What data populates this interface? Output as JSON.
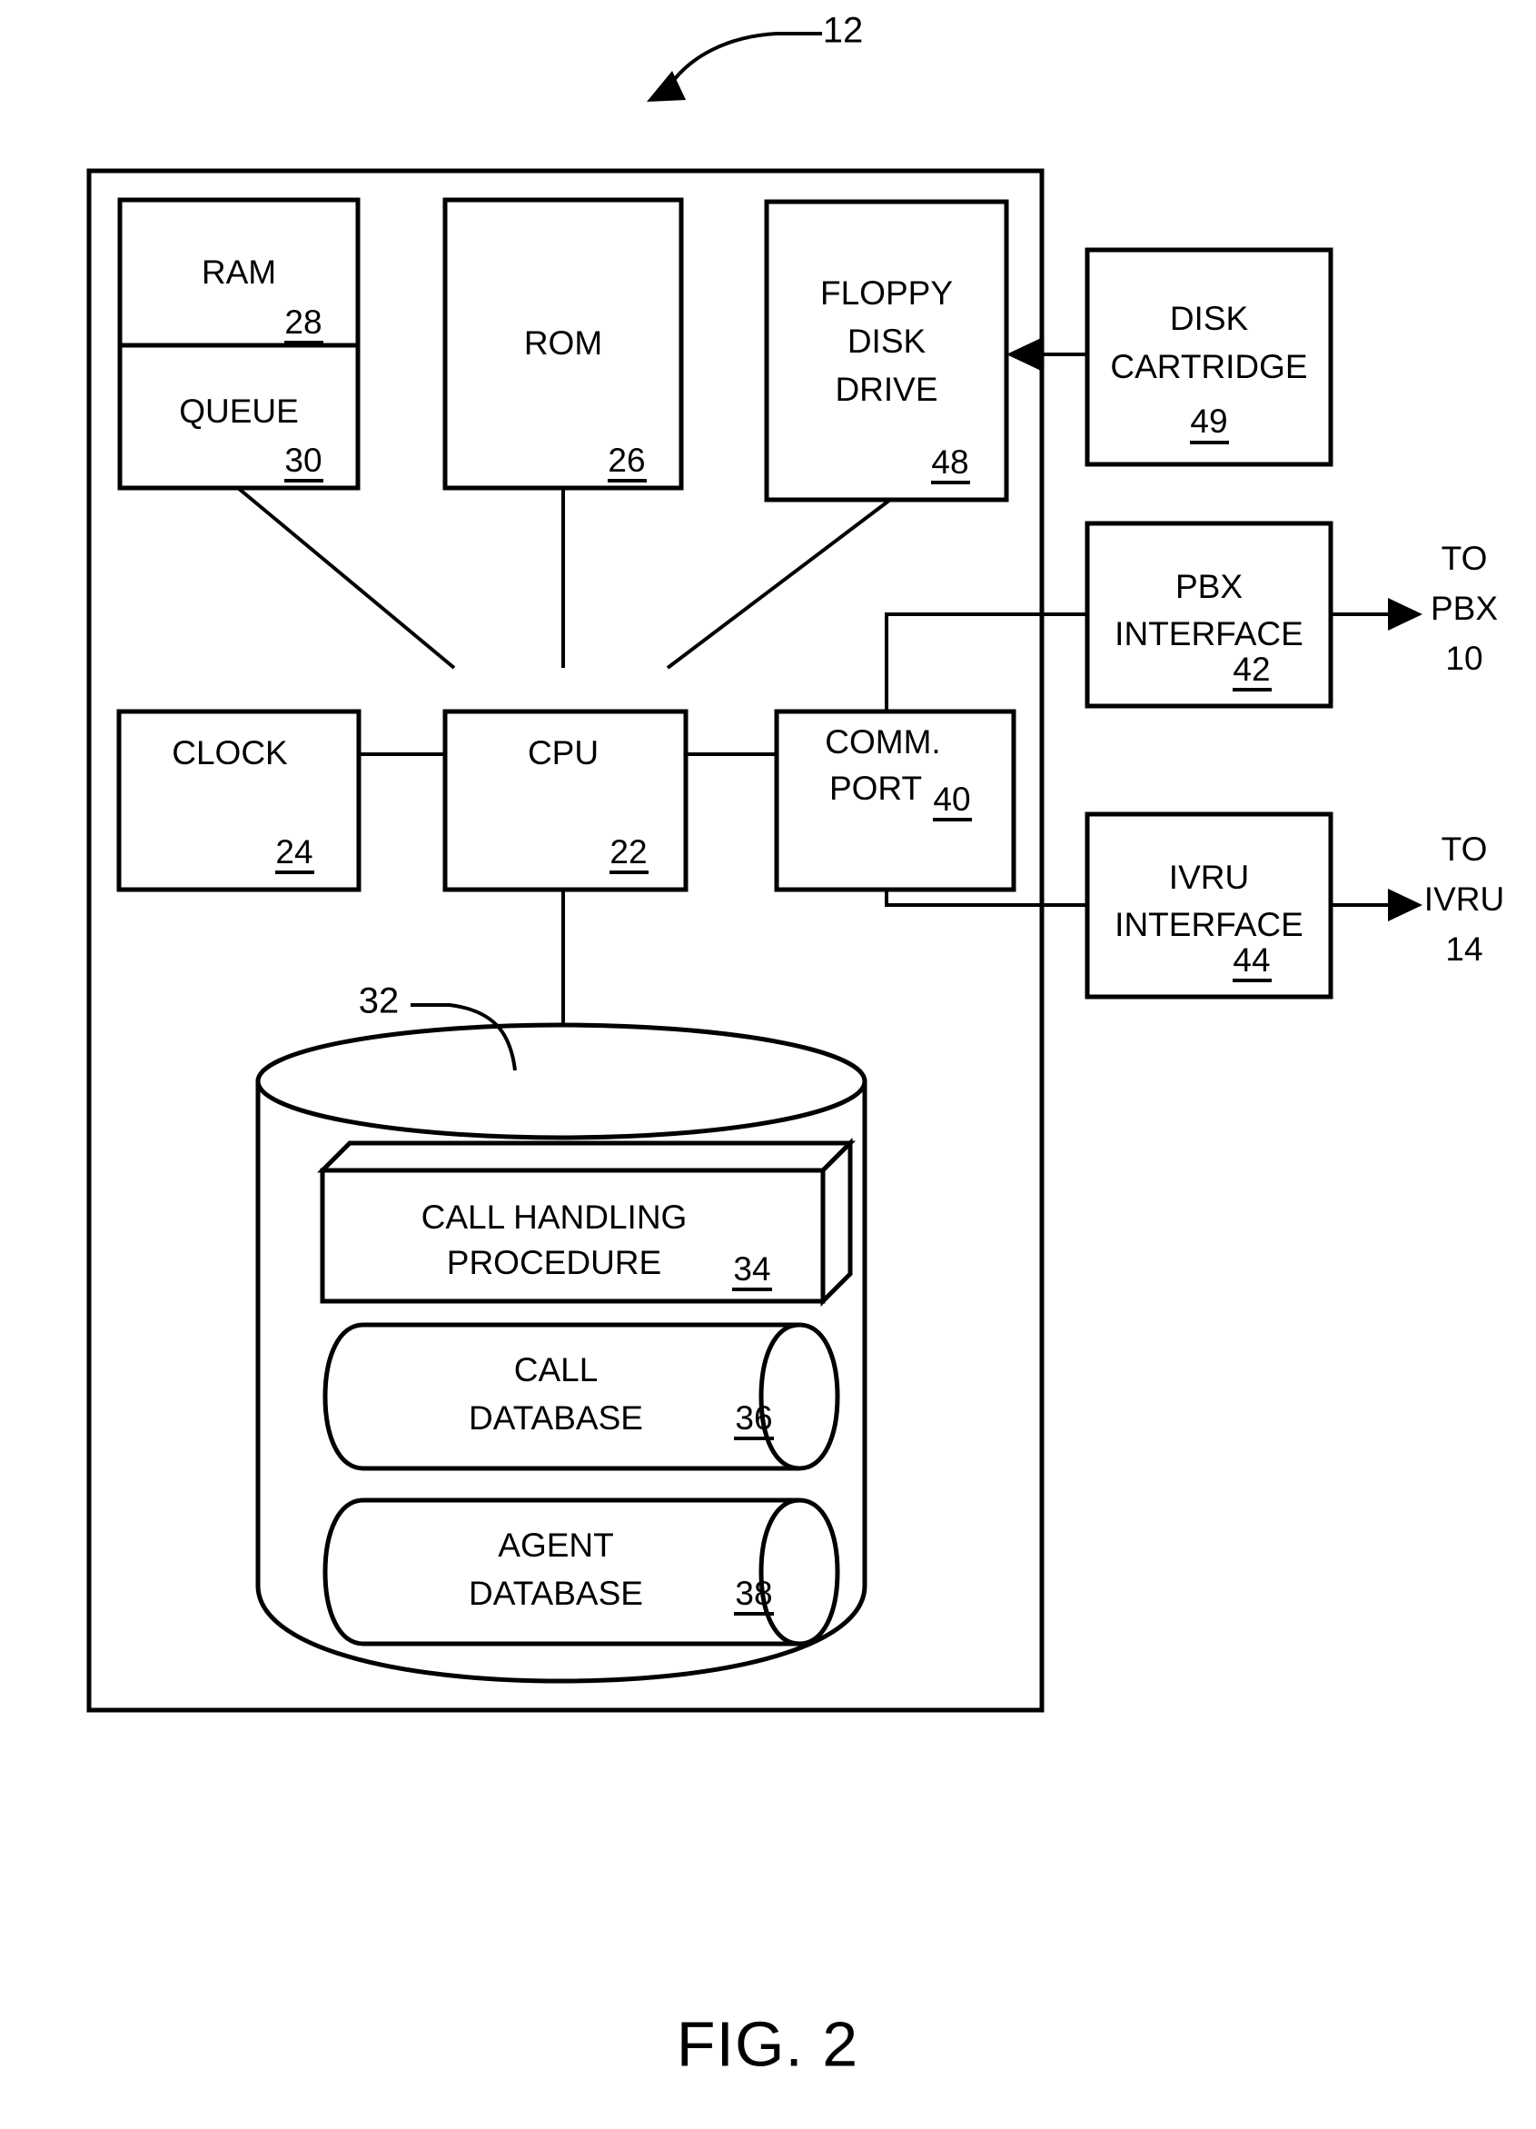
{
  "figure": {
    "caption": "FIG. 2",
    "top_reference_numeral": "12"
  },
  "blocks": {
    "ram": {
      "label": "RAM",
      "numeral": "28"
    },
    "queue": {
      "label": "QUEUE",
      "numeral": "30"
    },
    "rom": {
      "label": "ROM",
      "numeral": "26"
    },
    "floppy": {
      "label_line1": "FLOPPY",
      "label_line2": "DISK",
      "label_line3": "DRIVE",
      "numeral": "48"
    },
    "disk_cartridge": {
      "label_line1": "DISK",
      "label_line2": "CARTRIDGE",
      "numeral": "49"
    },
    "clock": {
      "label": "CLOCK",
      "numeral": "24"
    },
    "cpu": {
      "label": "CPU",
      "numeral": "22"
    },
    "comm_port": {
      "label_line1": "COMM.",
      "label_line2": "PORT",
      "numeral": "40"
    },
    "pbx_interface": {
      "label_line1": "PBX",
      "label_line2": "INTERFACE",
      "numeral": "42"
    },
    "ivru_interface": {
      "label_line1": "IVRU",
      "label_line2": "INTERFACE",
      "numeral": "44"
    },
    "storage": {
      "numeral": "32"
    },
    "call_handling_procedure": {
      "label_line1": "CALL HANDLING",
      "label_line2": "PROCEDURE",
      "numeral": "34"
    },
    "call_database": {
      "label_line1": "CALL",
      "label_line2": "DATABASE",
      "numeral": "36"
    },
    "agent_database": {
      "label_line1": "AGENT",
      "label_line2": "DATABASE",
      "numeral": "38"
    }
  },
  "external_labels": {
    "to_pbx": {
      "line1": "TO",
      "line2": "PBX",
      "line3": "10"
    },
    "to_ivru": {
      "line1": "TO",
      "line2": "IVRU",
      "line3": "14"
    }
  },
  "colors": {
    "ink": "#000000",
    "paper": "#ffffff"
  }
}
